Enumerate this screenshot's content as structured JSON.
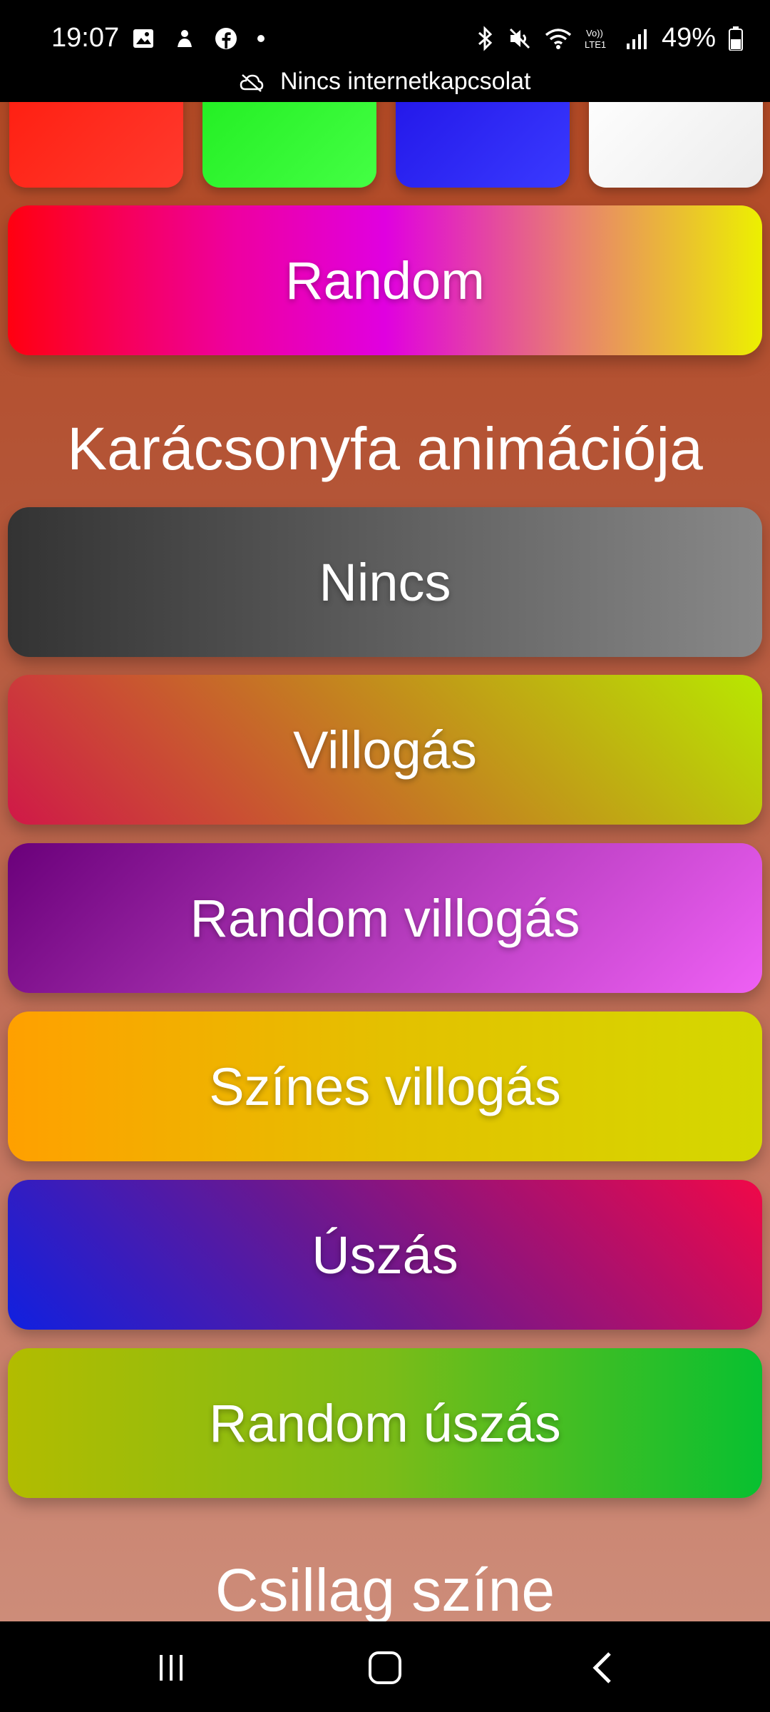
{
  "status": {
    "time": "19:07",
    "battery": "49%",
    "network_banner": "Nincs internetkapcsolat"
  },
  "color_swatches": [
    {
      "name": "red",
      "color": "#ff2a1a"
    },
    {
      "name": "green",
      "color": "#2ef02a"
    },
    {
      "name": "blue",
      "color": "#2a25ee"
    },
    {
      "name": "white",
      "color": "#f4f4f4"
    }
  ],
  "random_button": {
    "label": "Random"
  },
  "animation_section": {
    "title": "Karácsonyfa animációja",
    "buttons": [
      {
        "label": "Nincs"
      },
      {
        "label": "Villogás"
      },
      {
        "label": "Random villogás"
      },
      {
        "label": "Színes villogás"
      },
      {
        "label": "Úszás"
      },
      {
        "label": "Random úszás"
      }
    ]
  },
  "star_section": {
    "title": "Csillag színe"
  },
  "nav": {
    "icons": [
      "recent-apps-icon",
      "home-icon",
      "back-icon"
    ]
  }
}
